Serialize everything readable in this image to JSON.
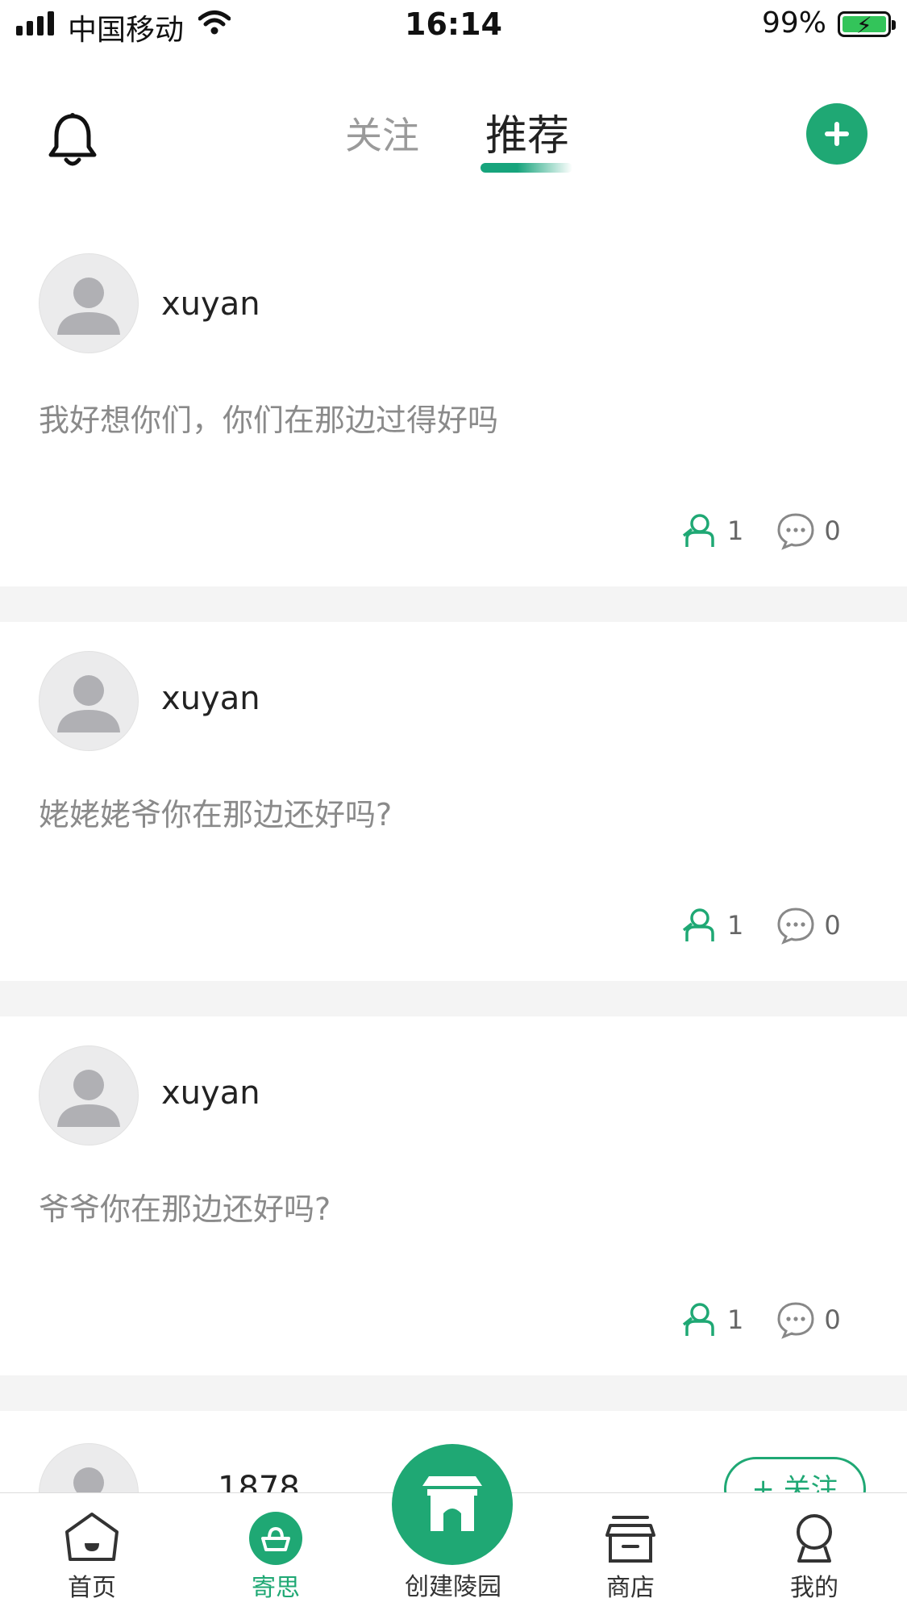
{
  "status_bar": {
    "carrier": "中国移动",
    "time": "16:14",
    "battery": "99%"
  },
  "header": {
    "tabs": [
      {
        "label": "关注",
        "active": false
      },
      {
        "label": "推荐",
        "active": true
      }
    ],
    "icons": {
      "left": "bell-icon",
      "right": "plus-icon"
    },
    "accent_color": "#1fa874"
  },
  "posts": [
    {
      "username": "xuyan",
      "content": "我好想你们，你们在那边过得好吗",
      "likes": "1",
      "comments": "0"
    },
    {
      "username": "xuyan",
      "content": "姥姥姥爷你在那边还好吗?",
      "likes": "1",
      "comments": "0"
    },
    {
      "username": "xuyan",
      "content": "爷爷你在那边还好吗?",
      "likes": "1",
      "comments": "0"
    }
  ],
  "partial_post": {
    "username": "1878",
    "follow_label": "+ 关注"
  },
  "tabbar": {
    "items": [
      {
        "label": "首页",
        "icon": "home-icon"
      },
      {
        "label": "寄思",
        "icon": "offering-basket-icon",
        "active": true
      },
      {
        "label": "创建陵园",
        "icon": "memorial-gate-icon"
      },
      {
        "label": "商店",
        "icon": "store-icon"
      },
      {
        "label": "我的",
        "icon": "profile-icon"
      }
    ]
  }
}
